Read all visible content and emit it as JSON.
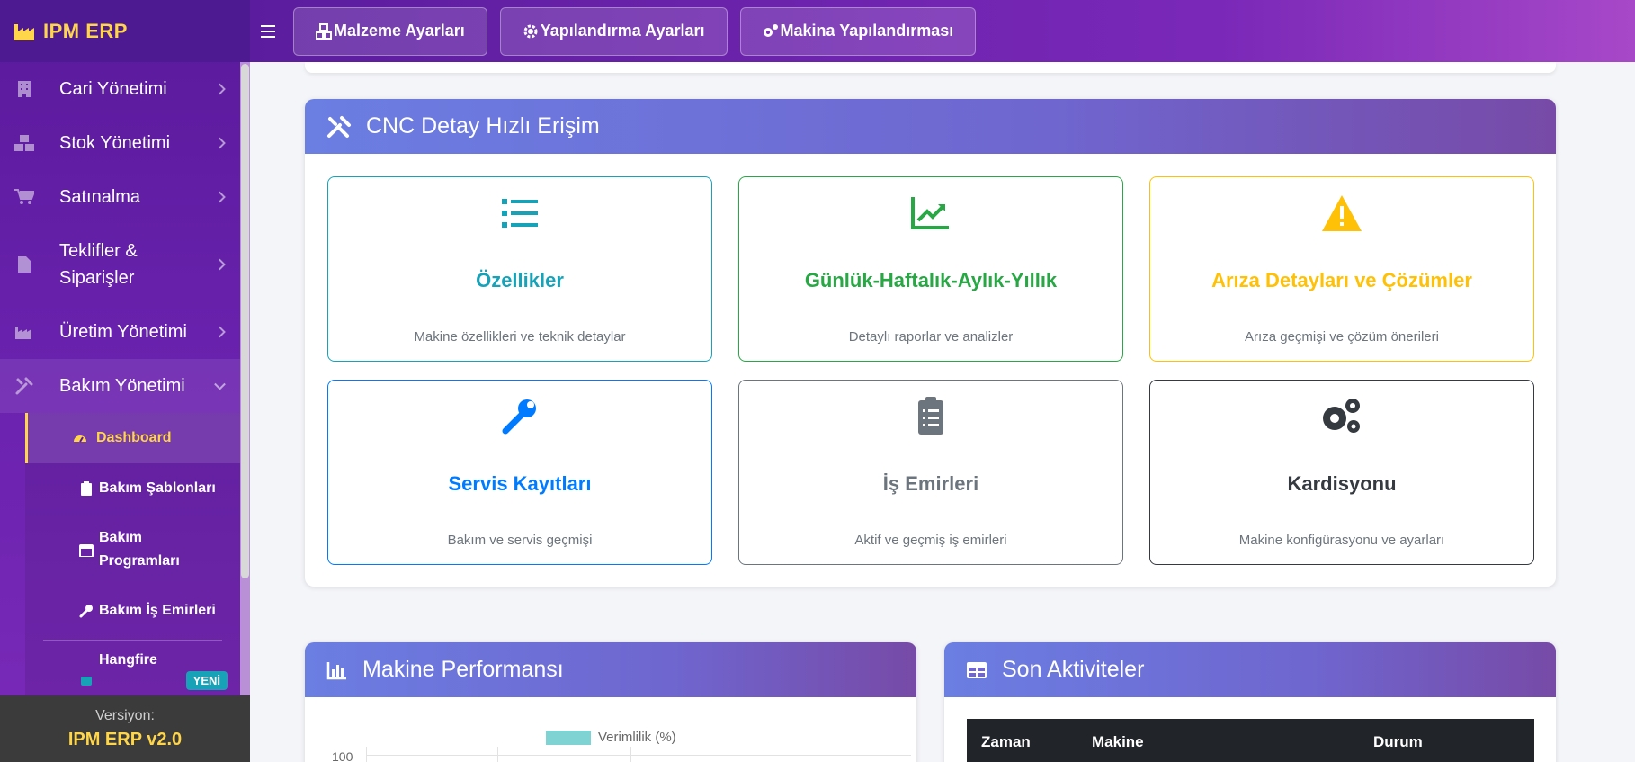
{
  "app": {
    "brand": "IPM ERP"
  },
  "sidebar": {
    "items": [
      {
        "label": "Cari Yönetimi",
        "icon": "building-icon"
      },
      {
        "label": "Stok Yönetimi",
        "icon": "boxes-icon"
      },
      {
        "label": "Satınalma",
        "icon": "cart-icon"
      },
      {
        "label": "Teklifler & Siparişler",
        "icon": "file-invoice-icon"
      },
      {
        "label": "Üretim Yönetimi",
        "icon": "industry-icon"
      },
      {
        "label": "Bakım Yönetimi",
        "icon": "tools-icon"
      }
    ],
    "sub_items": [
      {
        "label": "Dashboard",
        "icon": "tachometer-icon",
        "active": true
      },
      {
        "label": "Bakım Şablonları",
        "icon": "clipboard-icon"
      },
      {
        "label": "Bakım Programları",
        "icon": "calendar-icon"
      },
      {
        "label": "Bakım İş Emirleri",
        "icon": "wrench-icon"
      },
      {
        "label": "Hangfire",
        "icon": "robot-icon",
        "badge": "YENİ"
      }
    ],
    "version_label": "Versiyon:",
    "version_value": "IPM ERP v2.0"
  },
  "topbar": {
    "buttons": [
      {
        "label": "Malzeme Ayarları",
        "icon": "cubes-icon"
      },
      {
        "label": "Yapılandırma Ayarları",
        "icon": "gear-icon"
      },
      {
        "label": "Makina Yapılandırması",
        "icon": "gears-icon"
      }
    ]
  },
  "quick_access": {
    "title": "CNC Detay Hızlı Erişim",
    "tiles": [
      {
        "title": "Özellikler",
        "desc": "Makine özellikleri ve teknik detaylar",
        "color": "#17a2b8",
        "icon": "list-icon"
      },
      {
        "title": "Günlük-Haftalık-Aylık-Yıllık",
        "desc": "Detaylı raporlar ve analizler",
        "color": "#28a745",
        "icon": "chart-line-icon"
      },
      {
        "title": "Arıza Detayları ve Çözümler",
        "desc": "Arıza geçmişi ve çözüm önerileri",
        "color": "#ffc107",
        "icon": "warning-icon"
      },
      {
        "title": "Servis Kayıtları",
        "desc": "Bakım ve servis geçmişi",
        "color": "#007bff",
        "icon": "wrench-icon"
      },
      {
        "title": "İş Emirleri",
        "desc": "Aktif ve geçmiş iş emirleri",
        "color": "#6c757d",
        "icon": "clipboard-list-icon"
      },
      {
        "title": "Kardisyonu",
        "desc": "Makine konfigürasyonu ve ayarları",
        "color": "#343a40",
        "icon": "gears-icon"
      }
    ]
  },
  "performance": {
    "title": "Makine Performansı",
    "legend": "Verimlilik (%)",
    "y_tick_top": "100"
  },
  "activities": {
    "title": "Son Aktiviteler",
    "columns": [
      "Zaman",
      "Makine",
      "Durum"
    ]
  }
}
